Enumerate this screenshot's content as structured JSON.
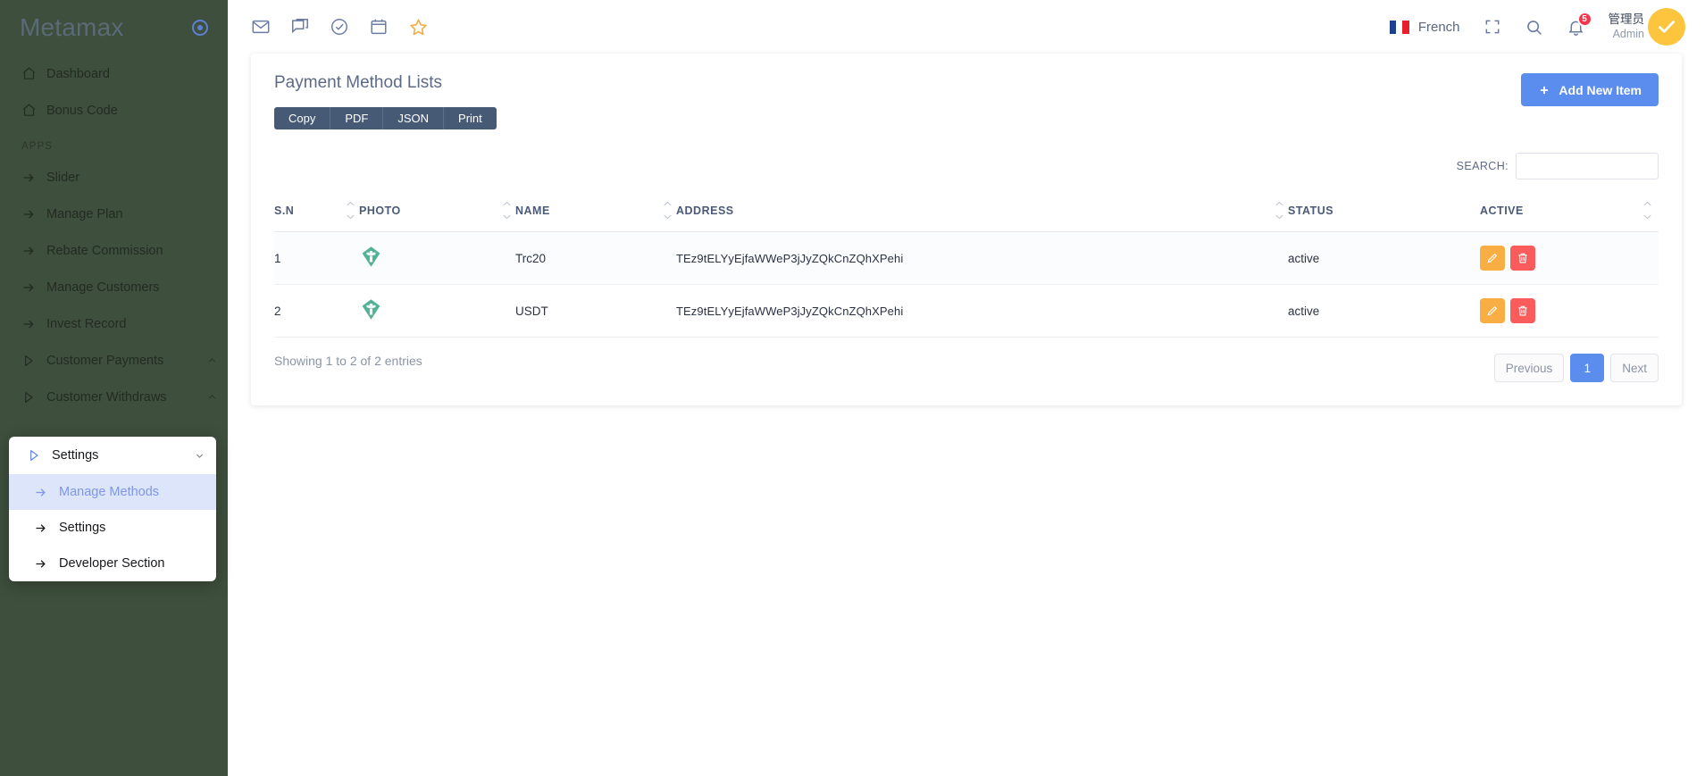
{
  "sidebar": {
    "brand": "Metamax",
    "logo_icon": "target-circle-icon",
    "primary_items": [
      {
        "label": "Dashboard",
        "icon": "home-icon"
      },
      {
        "label": "Bonus Code",
        "icon": "home-icon"
      }
    ],
    "section_label": "APPS",
    "app_items": [
      {
        "label": "Slider",
        "icon": "arrow-right-icon",
        "caret": ""
      },
      {
        "label": "Manage Plan",
        "icon": "arrow-right-icon",
        "caret": ""
      },
      {
        "label": "Rebate Commission",
        "icon": "arrow-right-icon",
        "caret": ""
      },
      {
        "label": "Manage Customers",
        "icon": "arrow-right-icon",
        "caret": ""
      },
      {
        "label": "Invest Record",
        "icon": "arrow-right-icon",
        "caret": ""
      },
      {
        "label": "Customer Payments",
        "icon": "triangle-right-icon",
        "caret": "chevron-up-icon"
      },
      {
        "label": "Customer Withdraws",
        "icon": "triangle-right-icon",
        "caret": "chevron-up-icon"
      }
    ],
    "submenu": {
      "header_label": "Settings",
      "header_icon": "triangle-right-icon",
      "header_caret": "chevron-down-icon",
      "items": [
        {
          "label": "Manage Methods",
          "icon": "arrow-right-icon",
          "active": true
        },
        {
          "label": "Settings",
          "icon": "arrow-right-icon",
          "active": false
        },
        {
          "label": "Developer Section",
          "icon": "arrow-right-icon",
          "active": false
        }
      ]
    }
  },
  "topbar": {
    "left_icons": [
      "mail-icon",
      "chat-icon",
      "check-circle-icon",
      "calendar-icon",
      "star-icon"
    ],
    "language": "French",
    "language_flag": "france-flag-icon",
    "fullscreen_icon": "fullscreen-icon",
    "search_icon": "search-icon",
    "notification_icon": "bell-icon",
    "notification_count": "5",
    "user_name": "管理员",
    "user_role": "Admin",
    "avatar_icon": "check-avatar-icon"
  },
  "content": {
    "title": "Payment Method Lists",
    "add_button": "Add New Item",
    "add_button_icon": "plus-icon",
    "export_buttons": [
      "Copy",
      "PDF",
      "JSON",
      "Print"
    ],
    "search_label": "SEARCH:",
    "search_value": "",
    "search_placeholder": "",
    "table": {
      "columns": [
        "S.N",
        "PHOTO",
        "NAME",
        "ADDRESS",
        "STATUS",
        "ACTIVE"
      ],
      "rows": [
        {
          "sn": "1",
          "photo_icon": "tether-logo-icon",
          "name": "Trc20",
          "address": "TEz9tELYyEjfaWWeP3jJyZQkCnZQhXPehi",
          "status": "active",
          "edit_icon": "pencil-icon",
          "delete_icon": "trash-icon"
        },
        {
          "sn": "2",
          "photo_icon": "tether-logo-icon",
          "name": "USDT",
          "address": "TEz9tELYyEjfaWWeP3jJyZQkCnZQhXPehi",
          "status": "active",
          "edit_icon": "pencil-icon",
          "delete_icon": "trash-icon"
        }
      ]
    },
    "entries_info": "Showing 1 to 2 of 2 entries",
    "pagination": {
      "previous": "Previous",
      "pages": [
        "1"
      ],
      "next": "Next",
      "current": "1"
    }
  },
  "colors": {
    "sidebar_bg": "#3e4f3d",
    "accent_blue": "#5b8def",
    "export_btn": "#465a75",
    "edit_orange": "#f8ae42",
    "delete_red": "#fa5b5b",
    "badge_red": "#f2364d",
    "avatar_yellow": "#fcc53d",
    "tether_green": "#50af95"
  }
}
